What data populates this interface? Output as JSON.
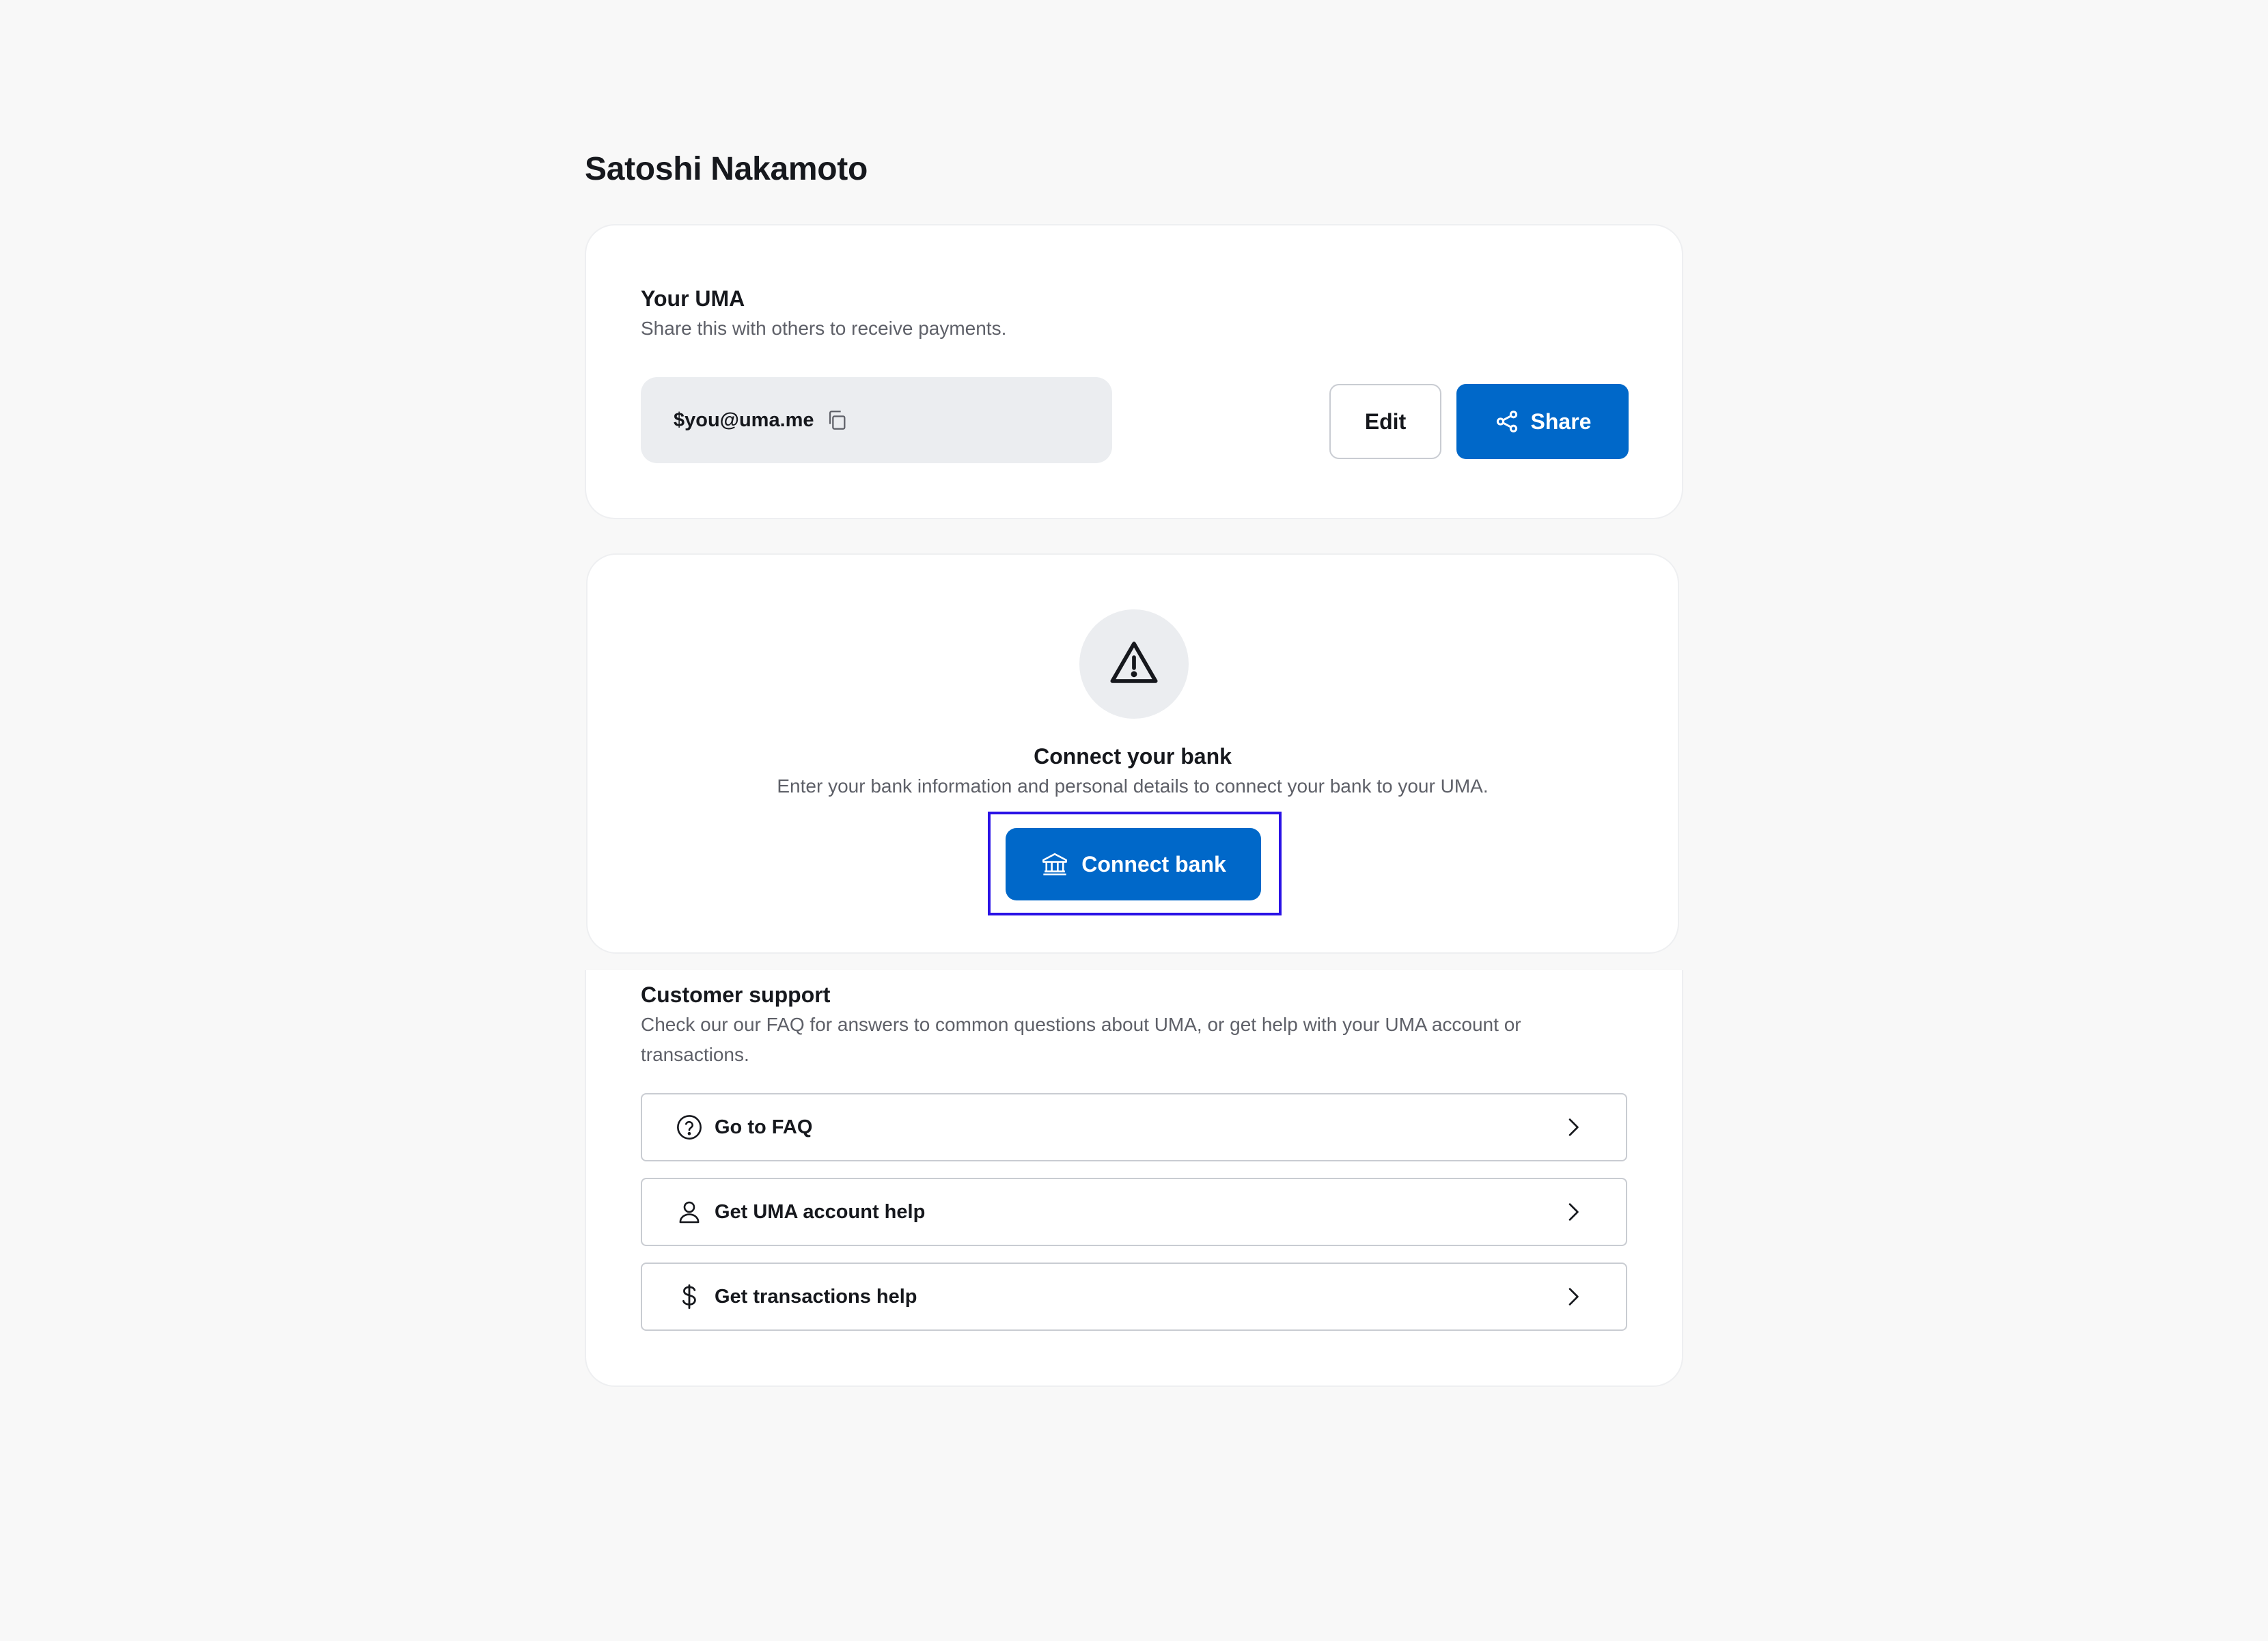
{
  "page": {
    "title": "Satoshi Nakamoto"
  },
  "uma_card": {
    "heading": "Your UMA",
    "subtitle": "Share this with others to receive payments.",
    "uma_value": "$you@uma.me",
    "edit_label": "Edit",
    "share_label": "Share"
  },
  "bank_card": {
    "heading": "Connect your bank",
    "subtitle": "Enter your bank information and personal details to connect your bank to your UMA.",
    "connect_label": "Connect bank"
  },
  "support": {
    "heading": "Customer support",
    "subtitle": "Check our our FAQ for answers to common questions about UMA, or get help with your UMA account or transactions.",
    "items": [
      {
        "label": "Go to FAQ",
        "icon": "question-circle-icon"
      },
      {
        "label": "Get UMA account help",
        "icon": "user-icon"
      },
      {
        "label": "Get transactions help",
        "icon": "dollar-icon"
      }
    ]
  },
  "colors": {
    "primary": "#0068c9",
    "background": "#f8f8f8",
    "highlight": "#2a12e6"
  }
}
